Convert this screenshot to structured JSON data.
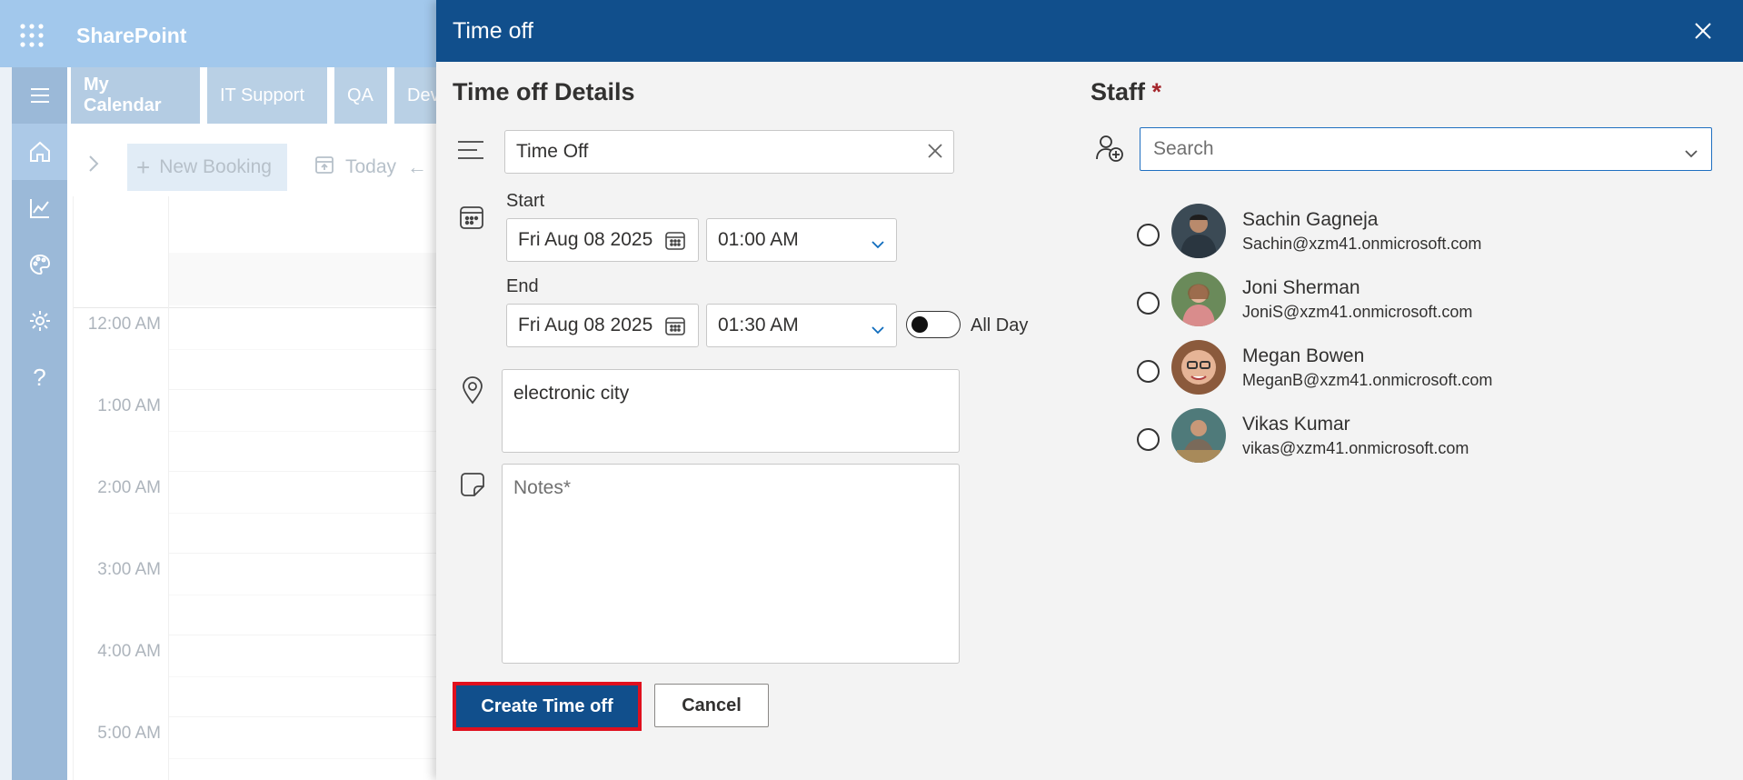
{
  "app": {
    "title": "SharePoint"
  },
  "tabs": [
    {
      "label": "My Calendar"
    },
    {
      "label": "IT Support"
    },
    {
      "label": "QA"
    },
    {
      "label": "Dev"
    }
  ],
  "toolbar": {
    "new_booking": "New Booking",
    "today": "Today"
  },
  "calendar": {
    "hours": [
      "12:00 AM",
      "1:00 AM",
      "2:00 AM",
      "3:00 AM",
      "4:00 AM",
      "5:00 AM"
    ]
  },
  "panel": {
    "title": "Time off",
    "details_title": "Time off Details",
    "title_value": "Time Off",
    "start_label": "Start",
    "start_date": "Fri Aug 08 2025",
    "start_time": "01:00 AM",
    "end_label": "End",
    "end_date": "Fri Aug 08 2025",
    "end_time": "01:30 AM",
    "all_day_label": "All Day",
    "location_value": "electronic city",
    "notes_placeholder": "Notes*",
    "create_label": "Create Time off",
    "cancel_label": "Cancel"
  },
  "staff": {
    "title": "Staff",
    "required_mark": "*",
    "search_placeholder": "Search",
    "members": [
      {
        "name": "Sachin Gagneja",
        "email": "Sachin@xzm41.onmicrosoft.com"
      },
      {
        "name": "Joni Sherman",
        "email": "JoniS@xzm41.onmicrosoft.com"
      },
      {
        "name": "Megan Bowen",
        "email": "MeganB@xzm41.onmicrosoft.com"
      },
      {
        "name": "Vikas Kumar",
        "email": "vikas@xzm41.onmicrosoft.com"
      }
    ]
  },
  "colors": {
    "brand": "#114f8c",
    "highlight_border": "#e0101e",
    "required": "#a4262c"
  }
}
